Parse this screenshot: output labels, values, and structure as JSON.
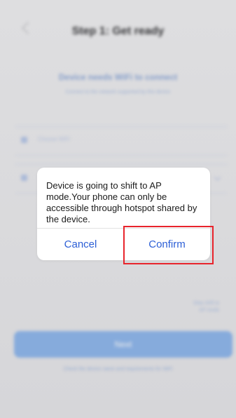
{
  "header": {
    "title": "Step 1: Get ready",
    "back_icon": "chevron-left-icon"
  },
  "main": {
    "headline": "Device needs WiFi to connect",
    "subline": "Connect to the network supported by this device",
    "wifi_field": {
      "icon": "wifi-icon",
      "placeholder": "Choose WiFi"
    },
    "password_field": {
      "icon": "lock-icon"
    },
    "mode_hint": [
      "Step shift to",
      "AP mode"
    ],
    "next_label": "Next",
    "footer_link": "Check the device name and requirements for WiFi"
  },
  "dialog": {
    "message": "Device is going to shift to AP mode.Your phone can only be accessible through hotspot shared by the device.",
    "cancel_label": "Cancel",
    "confirm_label": "Confirm"
  },
  "colors": {
    "accent": "#2c5fd6",
    "highlight": "#e8242c",
    "next_button": "#8fb6ea"
  }
}
